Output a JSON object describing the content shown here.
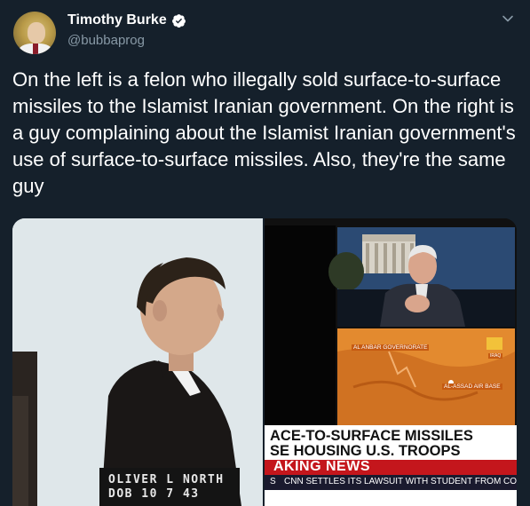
{
  "author": {
    "display_name": "Timothy Burke",
    "handle": "@bubbaprog",
    "verified_icon": "verified-badge-icon",
    "avatar_icon": "avatar-photo"
  },
  "tweet": {
    "text": "On the left is a felon who illegally sold surface-to-surface missiles to the Islamist Iranian government. On the right is a guy complaining about the Islamist Iranian government's use of surface-to-surface missiles. Also, they're the same guy"
  },
  "menu": {
    "icon": "chevron-down-icon"
  },
  "media": {
    "left": {
      "placard_text": "OLIVER L NORTH\nDOB 10 7 43"
    },
    "right": {
      "map_labels": [
        "AL ANBAR GOVERNORATE",
        "AL-ASSAD AIR BASE",
        "IRAQ"
      ],
      "headline_line1": "ACE-TO-SURFACE MISSILES",
      "headline_line2": "SE HOUSING U.S. TROOPS",
      "breaking_label": "AKING NEWS",
      "crawl_prefix": "S",
      "crawl_text": "CNN SETTLES ITS LAWSUIT WITH STUDENT FROM CO"
    }
  },
  "colors": {
    "background": "#15202b",
    "text": "#ffffff",
    "secondary_text": "#8899a6",
    "verified": "#ffffff",
    "breaking_red": "#c4161c"
  }
}
